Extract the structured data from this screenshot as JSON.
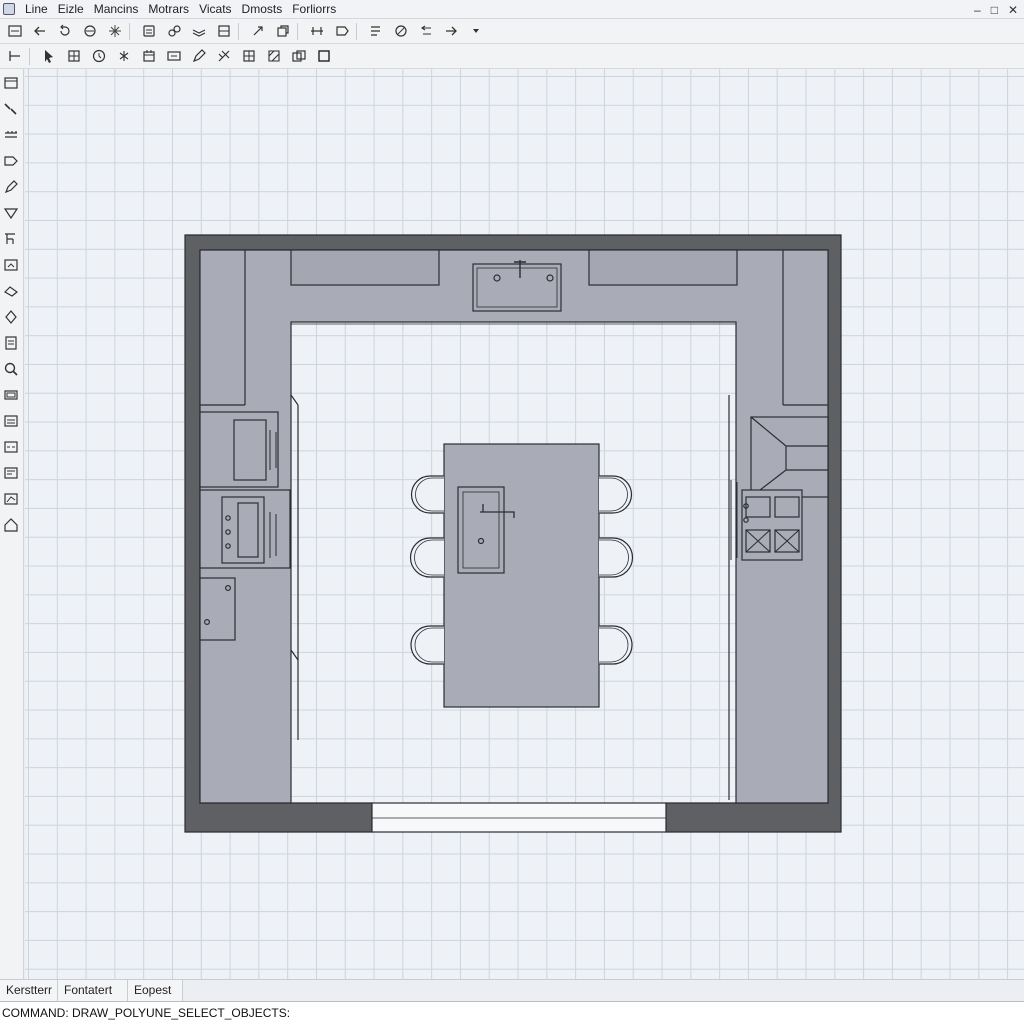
{
  "menu": {
    "items": [
      "Line",
      "Eizle",
      "Mancins",
      "Motrars",
      "Vicats",
      "Dmosts",
      "Forliorrs"
    ]
  },
  "window_controls": {
    "minimize": "–",
    "maximize": "□",
    "close": "✕"
  },
  "toolbar1": {
    "icons": [
      "open-icon",
      "back-arrow-icon",
      "undo-icon",
      "redo-icon",
      "snap-icon",
      "print-icon",
      "properties-icon",
      "layers-icon",
      "block-icon",
      "rotate-icon",
      "copy-icon",
      "dimension-icon",
      "edit-icon",
      "measure-icon",
      "orbit-icon",
      "align-icon",
      "forward-arrow-icon",
      "dropdown-icon"
    ]
  },
  "toolbar2": {
    "icons": [
      "line-icon",
      "pointer-icon",
      "table-icon",
      "clock-icon",
      "asterisk-icon",
      "calendar-icon",
      "text-icon",
      "pencil-icon",
      "trim-icon",
      "grid-icon",
      "hatch-icon",
      "group-icon",
      "rectangle-icon"
    ]
  },
  "palette": {
    "icons": [
      "window-icon",
      "brush-icon",
      "ruler-icon",
      "shape-icon",
      "pen-icon",
      "polygon-icon",
      "curve-icon",
      "image-icon",
      "eraser-icon",
      "pointer-icon",
      "sheet-icon",
      "zoom-icon",
      "frame-icon",
      "list-icon",
      "scan-icon",
      "note-icon",
      "chart-icon",
      "home-icon"
    ]
  },
  "tabs": [
    "Kerstterr",
    "Fontatert",
    "Eopest"
  ],
  "command": {
    "text": "COMMAND: DRAW_POLYUNE_SELECT_OBJECTS:"
  },
  "colors": {
    "wall": "#5e6064",
    "counter": "#a9acb6",
    "floor": "#eef1f6",
    "line": "#2b2d33"
  }
}
